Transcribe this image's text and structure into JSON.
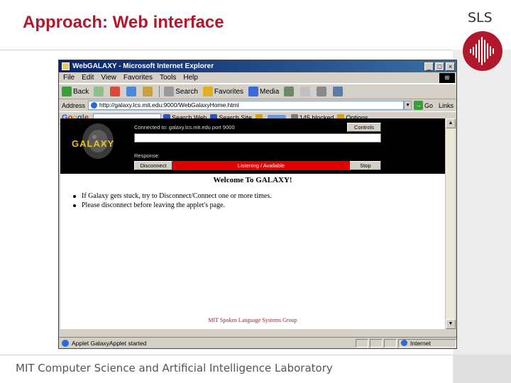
{
  "slide": {
    "title": "Approach: Web interface",
    "corner_label": "SLS",
    "footer": "MIT Computer Science and Artificial Intelligence Laboratory",
    "title_color": "#b2182b"
  },
  "browser": {
    "window_title": "WebGALAXY - Microsoft Internet Explorer",
    "window_buttons": [
      "_",
      "□",
      "×"
    ],
    "menu": [
      "File",
      "Edit",
      "View",
      "Favorites",
      "Tools",
      "Help"
    ],
    "toolbar": {
      "back_label": "Back",
      "search_label": "Search",
      "favorites_label": "Favorites",
      "media_label": "Media"
    },
    "address": {
      "label": "Address",
      "url": "http://galaxy.lcs.mit.edu:9000/WebGalaxyHome.html",
      "go_label": "Go",
      "links_label": "Links"
    },
    "google_bar": {
      "logo": [
        "G",
        "o",
        "o",
        "g",
        "l",
        "e"
      ],
      "search_web": "Search Web",
      "search_site": "Search Site",
      "popups_label": "145 blocked",
      "options_label": "Options"
    },
    "status": {
      "text": "Applet GalaxyApplet started",
      "zone": "Internet"
    }
  },
  "applet": {
    "logo": "GALAXY",
    "connected_text": "Connected to: galaxy.lcs.mit.edu port 9000",
    "controls_button": "Controls",
    "response_label": "Response:",
    "disconnect_button": "Disconnect",
    "listening_status": "Listening / Available",
    "stop_button": "Stop",
    "status_color": "#e00000"
  },
  "page": {
    "welcome": "Welcome To GALAXY!",
    "bullets": [
      "If Galaxy gets stuck, try to Disconnect/Connect one or more times.",
      "Please disconnect before leaving the applet's page."
    ],
    "footer": "MIT Spoken Language Systems Group"
  }
}
